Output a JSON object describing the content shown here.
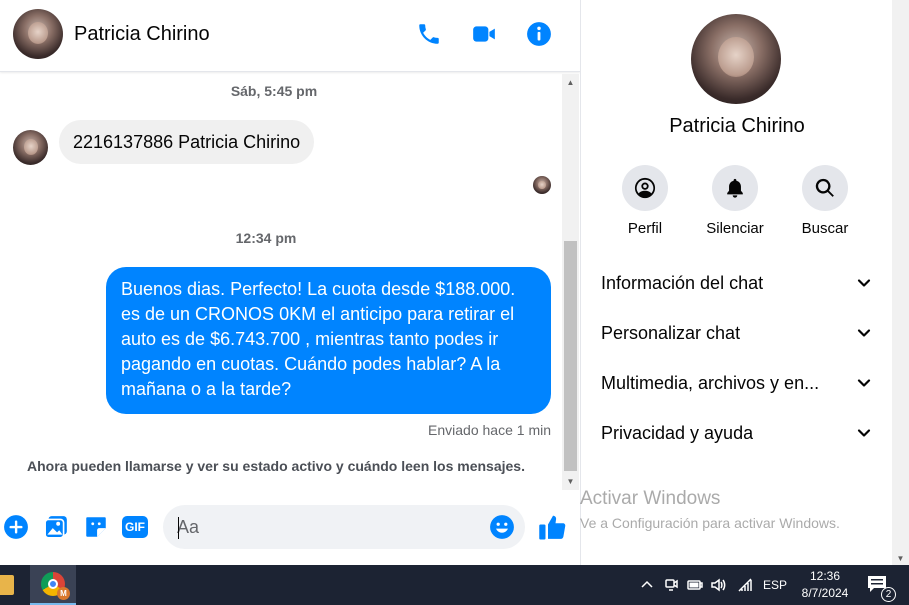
{
  "contact": {
    "name": "Patricia Chirino"
  },
  "header": {
    "icons": [
      "phone-icon",
      "video-camera-icon",
      "info-icon"
    ]
  },
  "conversation": {
    "timestamp_1": "Sáb, 5:45 pm",
    "incoming_message": "2216137886 Patricia Chirino",
    "timestamp_2": "12:34 pm",
    "outgoing_message": "Buenos dias. Perfecto! La cuota desde $188.000. es de un CRONOS 0KM el anticipo para retirar el auto es de $6.743.700 , mientras tanto podes ir pagando en cuotas. Cuándo podes hablar? A la mañana o a la tarde?",
    "sent_status": "Enviado hace 1 min",
    "notice": "Ahora pueden llamarse y ver su estado activo y cuándo leen los mensajes."
  },
  "composer": {
    "gif_label": "GIF",
    "placeholder": "Aa"
  },
  "details": {
    "actions": [
      {
        "label": "Perfil",
        "icon": "profile-icon"
      },
      {
        "label": "Silenciar",
        "icon": "bell-icon"
      },
      {
        "label": "Buscar",
        "icon": "search-icon"
      }
    ],
    "sections": [
      {
        "label": "Información del chat"
      },
      {
        "label": "Personalizar chat"
      },
      {
        "label": "Multimedia, archivos y en..."
      },
      {
        "label": "Privacidad y ayuda"
      }
    ]
  },
  "watermark": {
    "line1": "Activar Windows",
    "line2": "Ve a Configuración para activar Windows."
  },
  "taskbar": {
    "language": "ESP",
    "time": "12:36",
    "date": "8/7/2024",
    "notification_count": "2",
    "chrome_badge": "M"
  },
  "colors": {
    "accent": "#0084ff",
    "incoming_bubble": "#f0f0f0",
    "taskbar": "#1c2333"
  }
}
